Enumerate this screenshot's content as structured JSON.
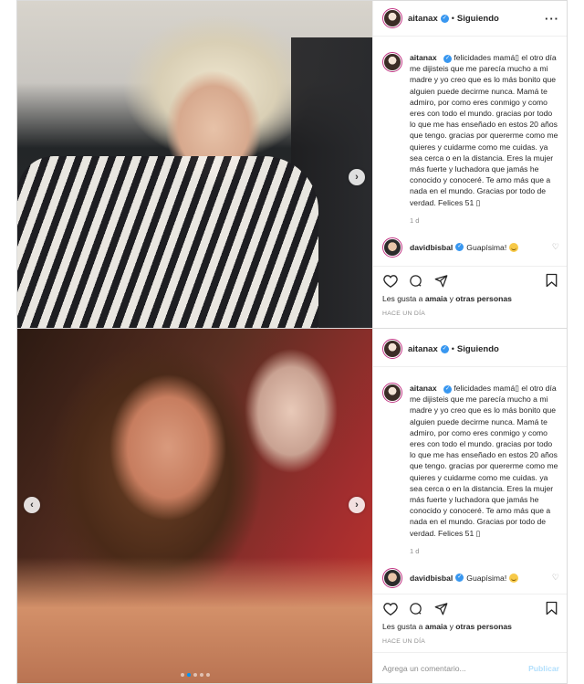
{
  "posts": [
    {
      "username": "aitanax",
      "follow_status": "Siguiendo",
      "caption_user": "aitanax",
      "caption": "felicidades mamá▯ el otro día me dijisteis que me parecía mucho a mi madre y yo creo que es lo más bonito que alguien puede decirme nunca. Mamá te admiro, por como eres conmigo y como eres con todo el mundo. gracias por todo lo que me has enseñado en estos 20 años que tengo. gracias por quererme como me quieres y cuidarme como me cuidas. ya sea cerca o en la distancia. Eres la mujer más fuerte y luchadora que jamás he conocido y conoceré. Te amo más que a nada en el mundo. Gracias por todo de verdad. Felices 51 ▯",
      "time": "1 d",
      "comment_user": "davidbisbal",
      "comment_text": "Guapísima!",
      "likes_prefix": "Les gusta a",
      "likes_user": "amaia",
      "likes_suffix": "y",
      "likes_others": "otras personas",
      "time_ago": "HACE UN DÍA"
    },
    {
      "username": "aitanax",
      "follow_status": "Siguiendo",
      "caption_user": "aitanax",
      "caption": "felicidades mamá▯ el otro día me dijisteis que me parecía mucho a mi madre y yo creo que es lo más bonito que alguien puede decirme nunca. Mamá te admiro, por como eres conmigo y como eres con todo el mundo. gracias por todo lo que me has enseñado en estos 20 años que tengo. gracias por quererme como me quieres y cuidarme como me cuidas. ya sea cerca o en la distancia. Eres la mujer más fuerte y luchadora que jamás he conocido y conoceré. Te amo más que a nada en el mundo. Gracias por todo de verdad. Felices 51 ▯",
      "time": "1 d",
      "comment_user": "davidbisbal",
      "comment_text": "Guapísima!",
      "likes_prefix": "Les gusta a",
      "likes_user": "amaia",
      "likes_suffix": "y",
      "likes_others": "otras personas",
      "time_ago": "HACE UN DÍA",
      "add_comment_placeholder": "Agrega un comentario...",
      "publish_label": "Publicar"
    }
  ],
  "icons": {
    "carousel_next": "chevron-right-icon",
    "carousel_prev": "chevron-left-icon",
    "like": "heart-icon",
    "comment": "comment-icon",
    "share": "share-icon",
    "save": "bookmark-icon",
    "more": "more-options-icon",
    "verified": "verified-badge-icon"
  },
  "colors": {
    "accent": "#0095f6",
    "verified": "#3897f0",
    "secondary_text": "#8e8e8e",
    "publish_disabled": "#b2dffc"
  }
}
